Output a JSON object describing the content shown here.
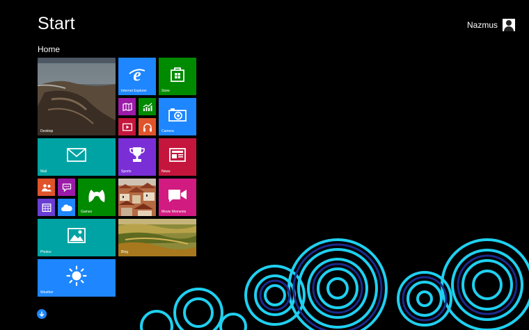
{
  "header": {
    "title": "Start",
    "group_label": "Home"
  },
  "user": {
    "name": "Nazmus",
    "icon": "user-account-icon"
  },
  "colors": {
    "background": "#000000",
    "blue": "#1e86ff",
    "green": "#008a00",
    "teal": "#00a3a3",
    "purple": "#7a2fd6",
    "magenta": "#d11b80",
    "crimson": "#c4163c",
    "orange": "#e0542b",
    "wave_accent": "#1fd0f0"
  },
  "tiles": {
    "desktop": {
      "label": "Desktop",
      "icon": "desktop-wallpaper"
    },
    "internet_explorer": {
      "label": "Internet Explorer",
      "icon": "internet-explorer-icon"
    },
    "store": {
      "label": "Store",
      "icon": "store-bag-icon"
    },
    "maps": {
      "label": "",
      "icon": "maps-icon"
    },
    "finance": {
      "label": "",
      "icon": "finance-chart-icon"
    },
    "video": {
      "label": "",
      "icon": "video-icon"
    },
    "music": {
      "label": "",
      "icon": "headphones-icon"
    },
    "camera": {
      "label": "Camera",
      "icon": "camera-icon"
    },
    "mail": {
      "label": "Mail",
      "icon": "mail-envelope-icon"
    },
    "sports": {
      "label": "Sports",
      "icon": "trophy-icon"
    },
    "news": {
      "label": "News",
      "icon": "newspaper-icon"
    },
    "people": {
      "label": "",
      "icon": "people-icon"
    },
    "messaging": {
      "label": "",
      "icon": "messaging-icon"
    },
    "calendar": {
      "label": "",
      "icon": "calendar-icon"
    },
    "skydrive": {
      "label": "",
      "icon": "cloud-icon"
    },
    "games": {
      "label": "Games",
      "icon": "game-controller-icon"
    },
    "travel_photo": {
      "label": "",
      "icon": "city-rooftops-photo"
    },
    "movie_moments": {
      "label": "Movie Moments",
      "icon": "movie-camera-icon"
    },
    "photos": {
      "label": "Photos",
      "icon": "picture-icon"
    },
    "bing": {
      "label": "Bing",
      "icon": "landscape-photo"
    },
    "weather": {
      "label": "Weather",
      "icon": "sun-icon"
    }
  },
  "navigation": {
    "all_apps_icon": "down-arrow-icon"
  }
}
